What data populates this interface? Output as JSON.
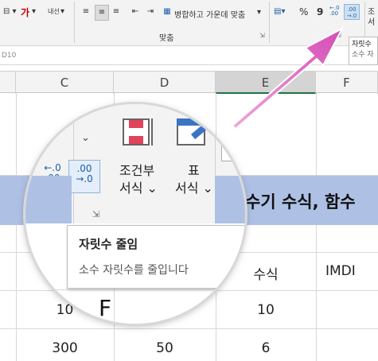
{
  "ribbon": {
    "top_left": {
      "font_color_glyph": "가",
      "small_label": "내선"
    },
    "merge_center_label": "병합하고 가운데 맞춤",
    "alignment_group_label": "맞춤",
    "number": {
      "percent": "%",
      "comma": "9"
    },
    "partial_right": {
      "top": "조",
      "bottom": "서"
    }
  },
  "tooltip_small": {
    "title": "자릿수",
    "desc": "소수 자"
  },
  "name_box": "D10",
  "columns": [
    "C",
    "D",
    "E",
    "F"
  ],
  "rows": [
    {
      "c": "",
      "d": "",
      "e": "",
      "f": ""
    },
    {
      "c": "",
      "d": "",
      "e": "수식",
      "f": "IMDI"
    },
    {
      "c": "10",
      "d": "F",
      "e": "10",
      "f": ""
    },
    {
      "c": "300",
      "d": "50",
      "e": "6",
      "f": ""
    }
  ],
  "banner_text": "수기 수식, 함수",
  "magnifier": {
    "conditional_format": {
      "line1": "조건부",
      "line2": "서식"
    },
    "table_format": {
      "line1": "표",
      "line2": "서식"
    },
    "decrease_decimal_tooltip": {
      "title": "자릿수 줄임",
      "desc": "소수 자릿수를 줄입니다"
    },
    "increase_decimal_digits": ".0\n.00",
    "decrease_decimal_digits": ".00\n.0"
  },
  "colors": {
    "accent_green": "#217346",
    "banner_blue": "#aec1e5",
    "arrow_pink": "#e879c6"
  }
}
